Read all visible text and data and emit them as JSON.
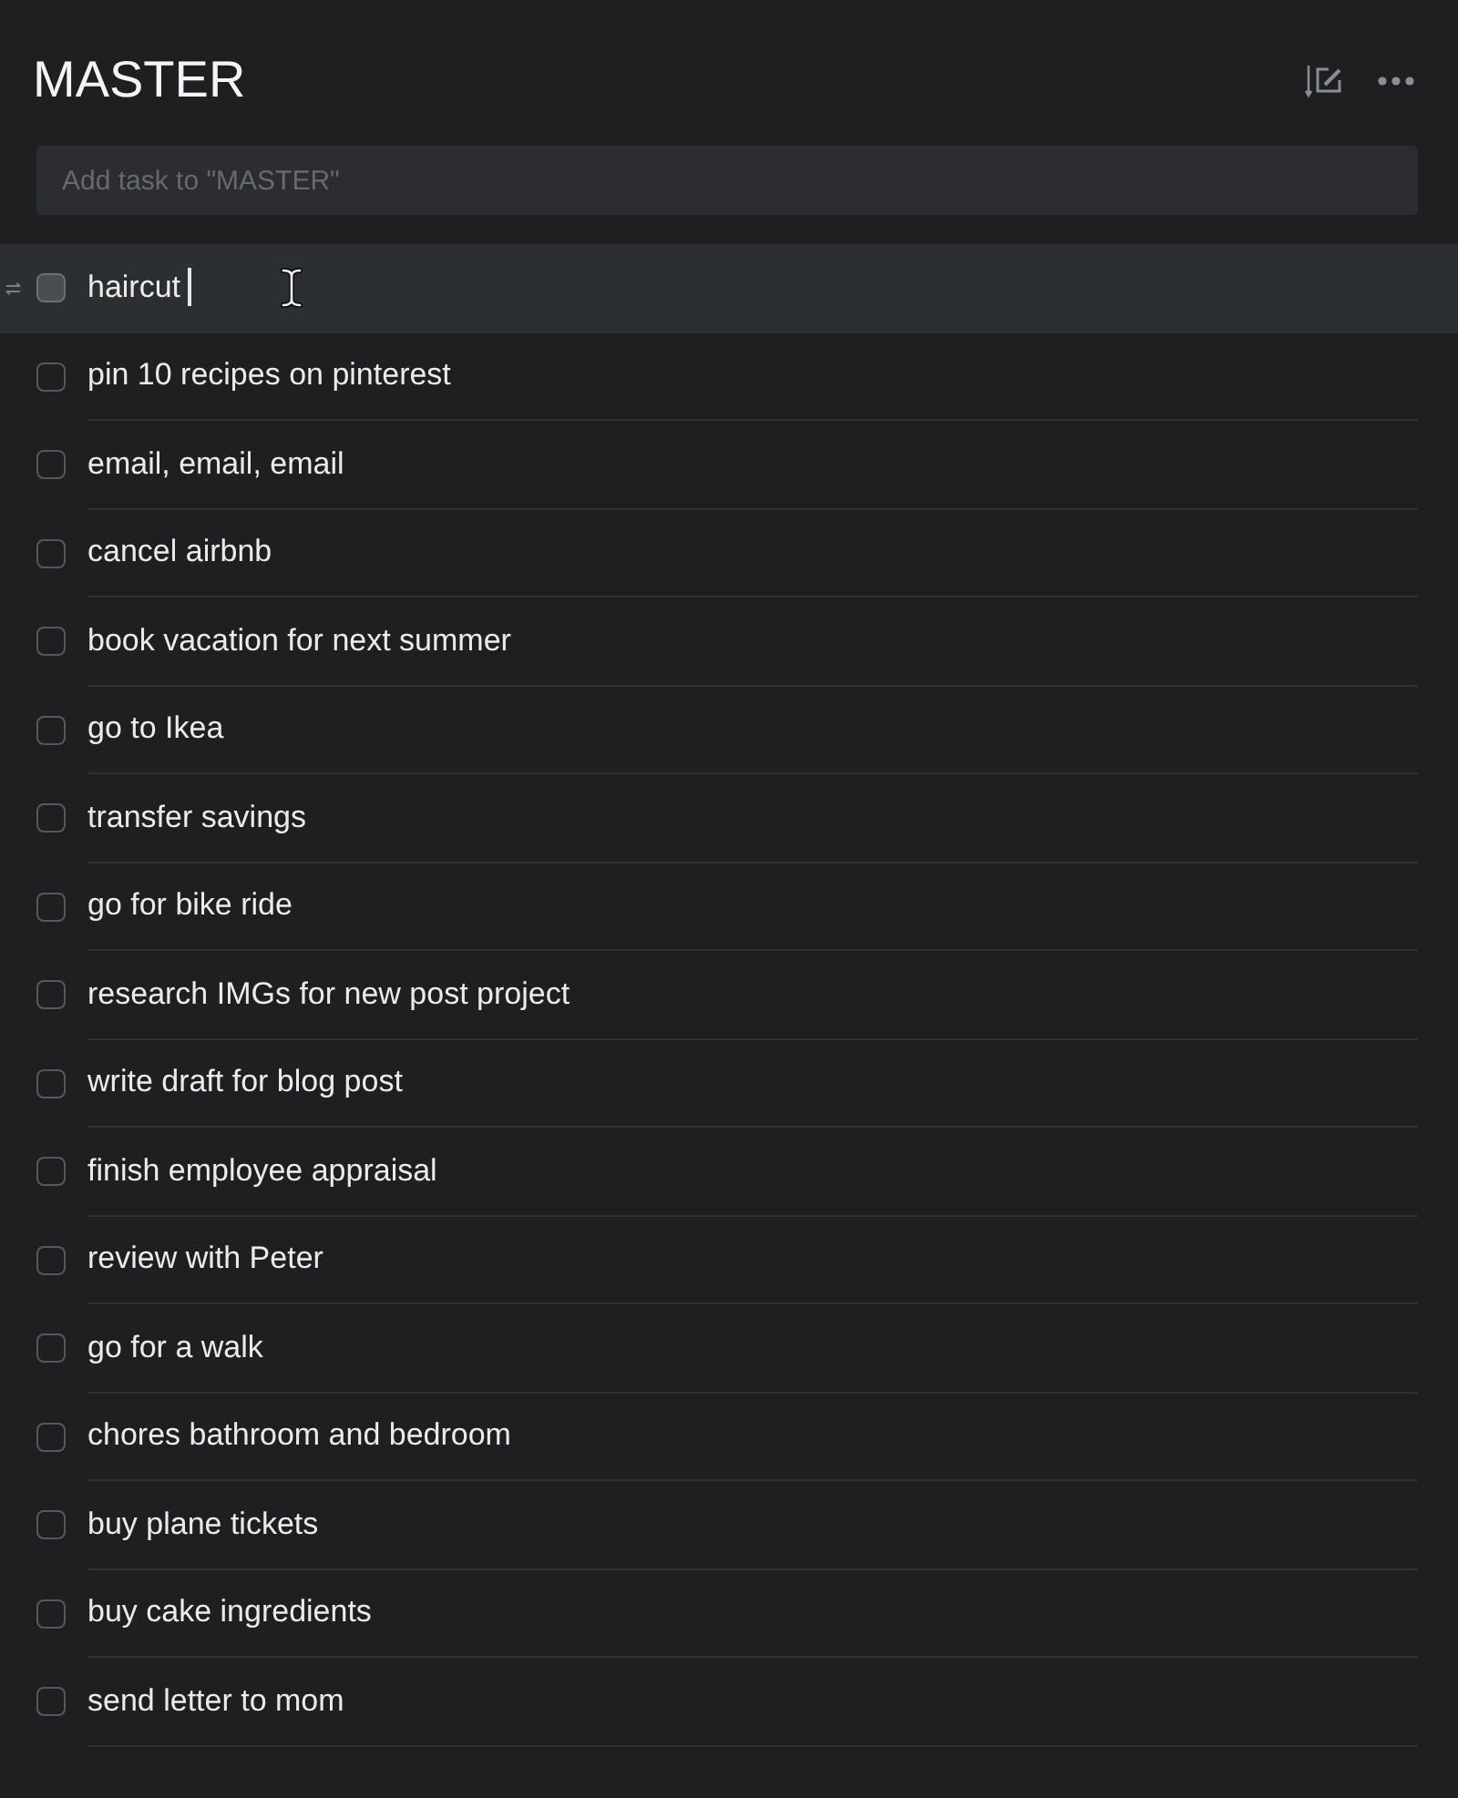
{
  "header": {
    "title": "MASTER"
  },
  "add_task": {
    "placeholder": "Add task to \"MASTER\""
  },
  "tasks": [
    {
      "text": "haircut",
      "selected": true,
      "checked": false
    },
    {
      "text": "pin 10 recipes on pinterest",
      "selected": false,
      "checked": false
    },
    {
      "text": "email, email, email",
      "selected": false,
      "checked": false
    },
    {
      "text": "cancel airbnb",
      "selected": false,
      "checked": false
    },
    {
      "text": "book vacation for next summer",
      "selected": false,
      "checked": false
    },
    {
      "text": "go to Ikea",
      "selected": false,
      "checked": false
    },
    {
      "text": "transfer savings",
      "selected": false,
      "checked": false
    },
    {
      "text": "go for bike ride",
      "selected": false,
      "checked": false
    },
    {
      "text": "research IMGs for new post project",
      "selected": false,
      "checked": false
    },
    {
      "text": "write draft for blog post",
      "selected": false,
      "checked": false
    },
    {
      "text": "finish employee appraisal",
      "selected": false,
      "checked": false
    },
    {
      "text": "review with Peter",
      "selected": false,
      "checked": false
    },
    {
      "text": "go for a walk",
      "selected": false,
      "checked": false
    },
    {
      "text": "chores bathroom and bedroom",
      "selected": false,
      "checked": false
    },
    {
      "text": "buy plane tickets",
      "selected": false,
      "checked": false
    },
    {
      "text": "buy cake ingredients",
      "selected": false,
      "checked": false
    },
    {
      "text": "send letter to mom",
      "selected": false,
      "checked": false
    }
  ]
}
